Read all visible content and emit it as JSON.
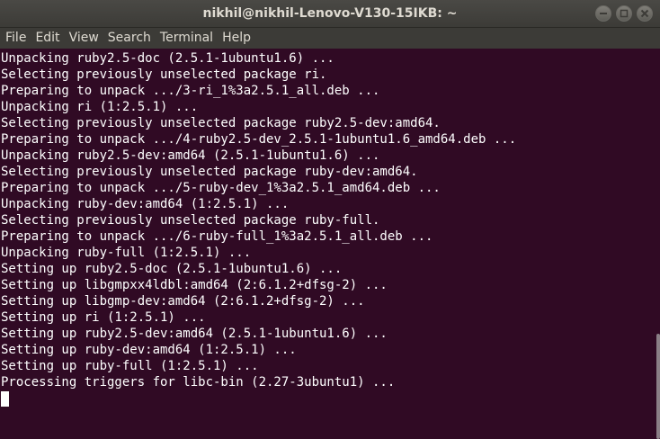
{
  "window": {
    "title": "nikhil@nikhil-Lenovo-V130-15IKB: ~"
  },
  "menu": {
    "items": [
      {
        "label": "File"
      },
      {
        "label": "Edit"
      },
      {
        "label": "View"
      },
      {
        "label": "Search"
      },
      {
        "label": "Terminal"
      },
      {
        "label": "Help"
      }
    ]
  },
  "terminal": {
    "lines": [
      "Unpacking ruby2.5-doc (2.5.1-1ubuntu1.6) ...",
      "Selecting previously unselected package ri.",
      "Preparing to unpack .../3-ri_1%3a2.5.1_all.deb ...",
      "Unpacking ri (1:2.5.1) ...",
      "Selecting previously unselected package ruby2.5-dev:amd64.",
      "Preparing to unpack .../4-ruby2.5-dev_2.5.1-1ubuntu1.6_amd64.deb ...",
      "Unpacking ruby2.5-dev:amd64 (2.5.1-1ubuntu1.6) ...",
      "Selecting previously unselected package ruby-dev:amd64.",
      "Preparing to unpack .../5-ruby-dev_1%3a2.5.1_amd64.deb ...",
      "Unpacking ruby-dev:amd64 (1:2.5.1) ...",
      "Selecting previously unselected package ruby-full.",
      "Preparing to unpack .../6-ruby-full_1%3a2.5.1_all.deb ...",
      "Unpacking ruby-full (1:2.5.1) ...",
      "Setting up ruby2.5-doc (2.5.1-1ubuntu1.6) ...",
      "Setting up libgmpxx4ldbl:amd64 (2:6.1.2+dfsg-2) ...",
      "Setting up libgmp-dev:amd64 (2:6.1.2+dfsg-2) ...",
      "Setting up ri (1:2.5.1) ...",
      "Setting up ruby2.5-dev:amd64 (2.5.1-1ubuntu1.6) ...",
      "Setting up ruby-dev:amd64 (1:2.5.1) ...",
      "Setting up ruby-full (1:2.5.1) ...",
      "Processing triggers for libc-bin (2.27-3ubuntu1) ..."
    ]
  },
  "colors": {
    "terminal_background": "#300a24",
    "terminal_text": "#ffffff",
    "titlebar": "#3c3b37",
    "title_text": "#dfdbd2"
  },
  "icons": {
    "minimize": "minimize-icon",
    "maximize": "maximize-icon",
    "close": "close-icon"
  }
}
